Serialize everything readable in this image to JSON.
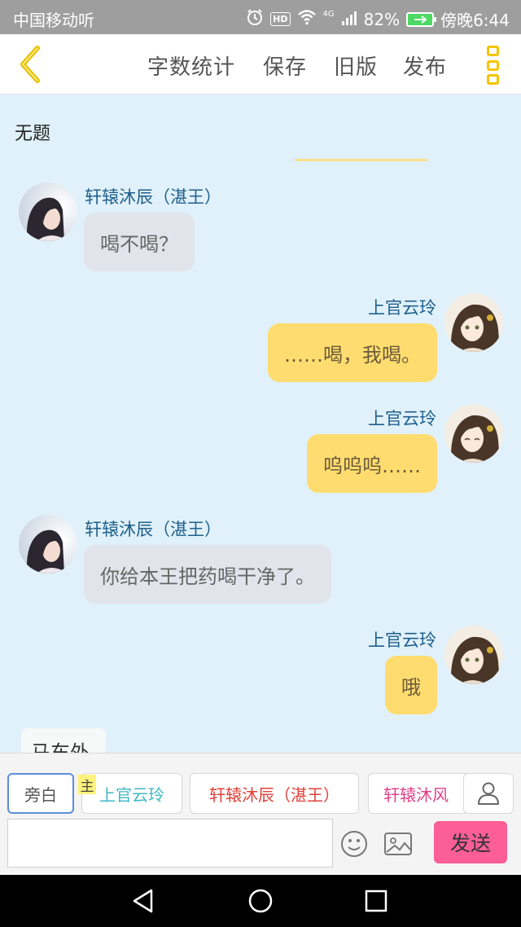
{
  "status_bar": {
    "carrier": "中国移动听",
    "network": "4G",
    "battery": "82%",
    "time": "傍晚6:44",
    "accent": "#4cd964"
  },
  "header": {
    "back_icon": "chevron-left-icon",
    "actions": [
      "字数统计",
      "保存",
      "旧版",
      "发布"
    ],
    "menu_icon": "more-vertical-icon",
    "accent": "#f5c400"
  },
  "story": {
    "title": "无题"
  },
  "messages": [
    {
      "side": "left",
      "speaker": "轩辕沐辰（湛王）",
      "text": "喝不喝？",
      "avatar": "male-avatar"
    },
    {
      "side": "right",
      "speaker": "上官云玲",
      "text": "……喝，我喝。",
      "avatar": "female-avatar"
    },
    {
      "side": "right",
      "speaker": "上官云玲",
      "text": "呜呜呜……",
      "avatar": "female-avatar"
    },
    {
      "side": "left",
      "speaker": "轩辕沐辰（湛王）",
      "text": "你给本王把药喝干净了。",
      "avatar": "male-avatar"
    },
    {
      "side": "right",
      "speaker": "上官云玲",
      "text": "哦",
      "avatar": "female-avatar"
    }
  ],
  "narration_partial": "马车外",
  "composer": {
    "roles": [
      {
        "label": "旁白",
        "color": "#555555"
      },
      {
        "label": "上官云玲",
        "color": "#3fb8c6",
        "marker": "主"
      },
      {
        "label": "轩辕沐辰（湛王）",
        "color": "#e0403a"
      },
      {
        "label": "轩辕沐风",
        "color": "#e0408a"
      }
    ],
    "person_icon": "person-icon",
    "input_value": "",
    "emoji_icon": "emoji-icon",
    "image_icon": "image-icon",
    "send_label": "发送",
    "send_color": "#fb5f95"
  },
  "nav": [
    "back-triangle-icon",
    "home-circle-icon",
    "recent-square-icon"
  ]
}
